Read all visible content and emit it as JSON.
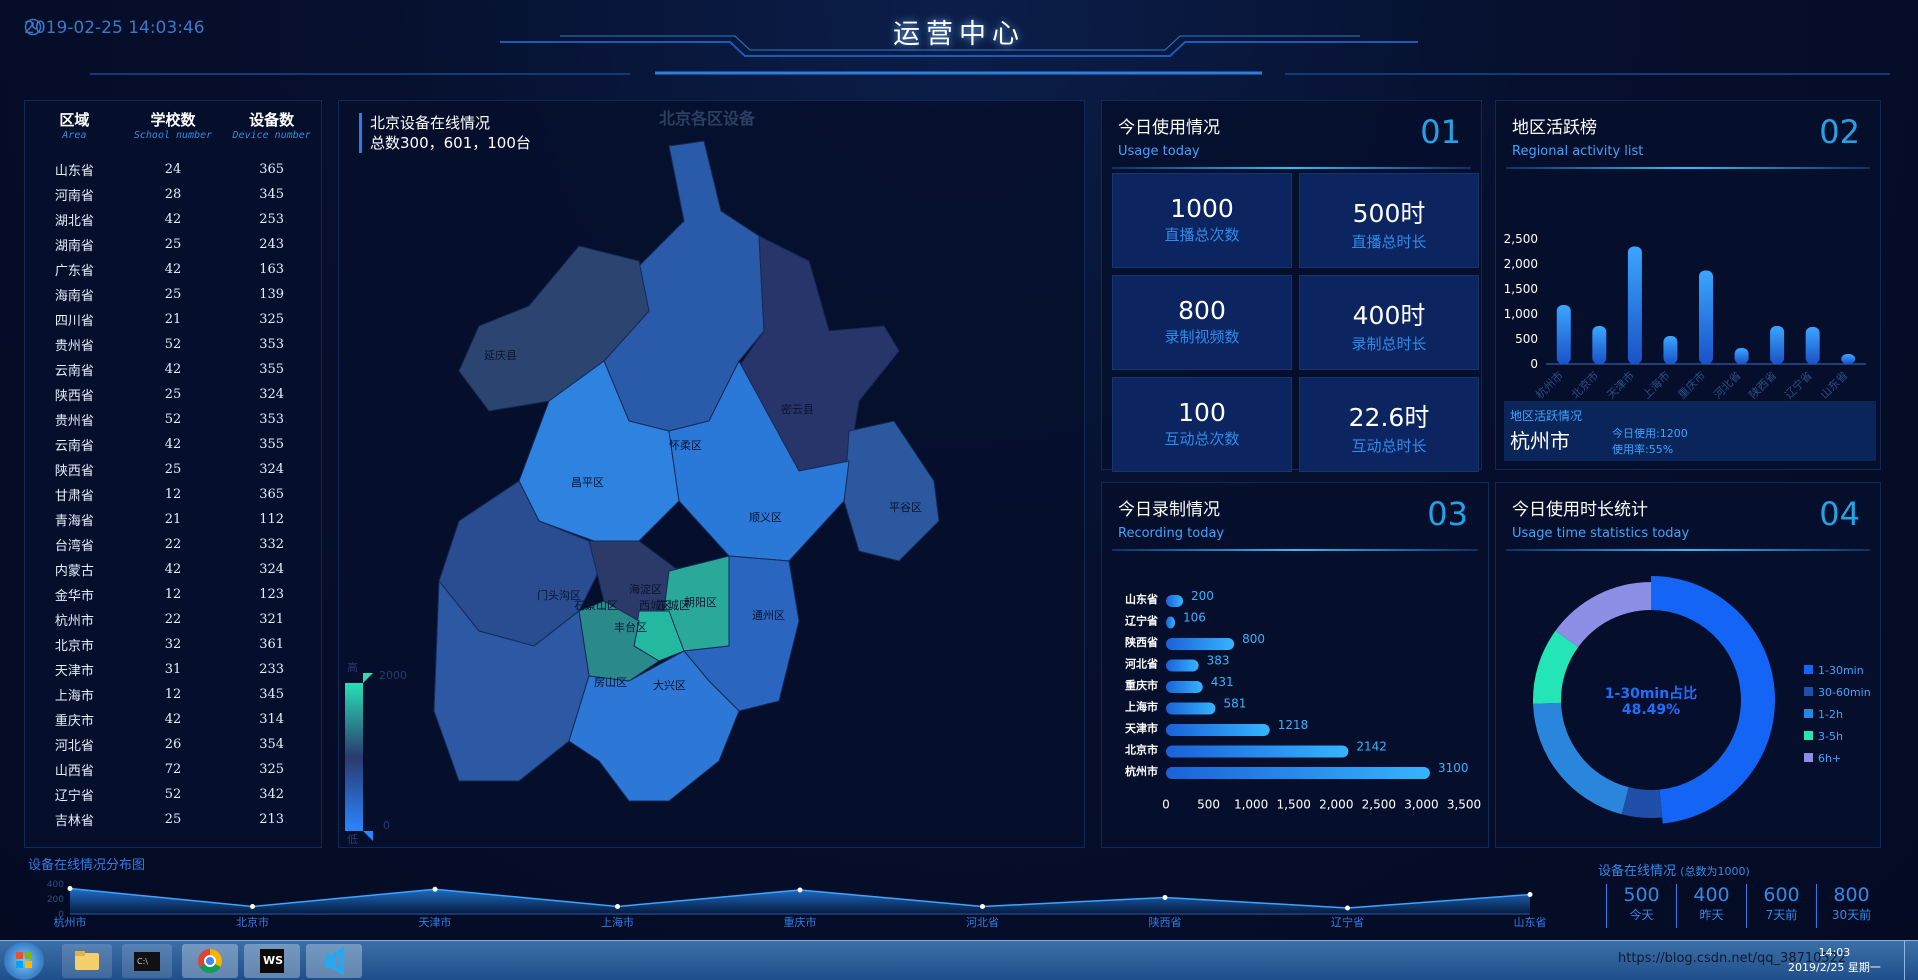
{
  "header": {
    "datetime": "2019-02-25 14:03:46",
    "title": "运营中心"
  },
  "table": {
    "headers": [
      {
        "cn": "区域",
        "en": "Area"
      },
      {
        "cn": "学校数",
        "en": "School number"
      },
      {
        "cn": "设备数",
        "en": "Device number"
      }
    ],
    "rows": [
      [
        "山东省",
        "24",
        "365"
      ],
      [
        "河南省",
        "28",
        "345"
      ],
      [
        "湖北省",
        "42",
        "253"
      ],
      [
        "湖南省",
        "25",
        "243"
      ],
      [
        "广东省",
        "42",
        "163"
      ],
      [
        "海南省",
        "25",
        "139"
      ],
      [
        "四川省",
        "21",
        "325"
      ],
      [
        "贵州省",
        "52",
        "353"
      ],
      [
        "云南省",
        "42",
        "355"
      ],
      [
        "陕西省",
        "25",
        "324"
      ],
      [
        "贵州省",
        "52",
        "353"
      ],
      [
        "云南省",
        "42",
        "355"
      ],
      [
        "陕西省",
        "25",
        "324"
      ],
      [
        "甘肃省",
        "12",
        "365"
      ],
      [
        "青海省",
        "21",
        "112"
      ],
      [
        "台湾省",
        "22",
        "332"
      ],
      [
        "内蒙古",
        "42",
        "324"
      ],
      [
        "金华市",
        "12",
        "123"
      ],
      [
        "杭州市",
        "22",
        "321"
      ],
      [
        "北京市",
        "32",
        "361"
      ],
      [
        "天津市",
        "31",
        "233"
      ],
      [
        "上海市",
        "12",
        "345"
      ],
      [
        "重庆市",
        "42",
        "314"
      ],
      [
        "河北省",
        "26",
        "354"
      ],
      [
        "山西省",
        "72",
        "325"
      ],
      [
        "辽宁省",
        "52",
        "342"
      ],
      [
        "吉林省",
        "25",
        "213"
      ]
    ]
  },
  "map": {
    "title": "北京设备在线情况",
    "subtitle": "总数300，601，100台",
    "bg_title": "北京各区设备",
    "legend": {
      "high": "高",
      "low": "低",
      "max": "2000",
      "min": "0"
    },
    "districts": [
      "延庆县",
      "怀柔区",
      "密云县",
      "昌平区",
      "顺义区",
      "平谷区",
      "门头沟区",
      "海淀区",
      "石景山区",
      "西城区",
      "东城区",
      "朝阳区",
      "丰台区",
      "通州区",
      "房山区",
      "大兴区"
    ]
  },
  "usage": {
    "title": "今日使用情况",
    "subtitle": "Usage today",
    "num": "01",
    "tiles": [
      {
        "value": "1000",
        "label": "直播总次数"
      },
      {
        "value": "500时",
        "label": "直播总时长"
      },
      {
        "value": "800",
        "label": "录制视频数"
      },
      {
        "value": "400时",
        "label": "录制总时长"
      },
      {
        "value": "100",
        "label": "互动总次数"
      },
      {
        "value": "22.6时",
        "label": "互动总时长"
      }
    ]
  },
  "activity": {
    "title": "地区活跃榜",
    "subtitle": "Regional activity list",
    "num": "02",
    "info": {
      "label": "地区活跃情况",
      "city": "杭州市",
      "today": "今日使用:1200",
      "rate": "使用率:55%"
    }
  },
  "recording": {
    "title": "今日录制情况",
    "subtitle": "Recording today",
    "num": "03"
  },
  "duration": {
    "title": "今日使用时长统计",
    "subtitle": "Usage time statistics today",
    "num": "04",
    "center_l1": "1-30min占比",
    "center_l2": "48.49%"
  },
  "online": {
    "title": "设备在线情况分布图"
  },
  "stats": {
    "title": "设备在线情况",
    "note": "(总数为1000)",
    "items": [
      {
        "value": "500",
        "label": "今天"
      },
      {
        "value": "400",
        "label": "昨天"
      },
      {
        "value": "600",
        "label": "7天前"
      },
      {
        "value": "800",
        "label": "30天前"
      }
    ]
  },
  "taskbar": {
    "time": "14:03",
    "date": "2019/2/25 星期一",
    "url": "https://blog.csdn.net/qq_38710522"
  },
  "colors": {
    "bg": "#040b24",
    "accent": "#2f8be8",
    "teal": "#28d2b0",
    "blue": "#1f6fff"
  },
  "chart_data": [
    {
      "type": "bar",
      "title": "地区活跃榜",
      "categories": [
        "杭州市",
        "北京市",
        "天津市",
        "上海市",
        "重庆市",
        "河北省",
        "陕西省",
        "辽宁省",
        "山东省"
      ],
      "values": [
        1180,
        760,
        2350,
        560,
        1870,
        320,
        760,
        740,
        200
      ],
      "ylim": [
        0,
        2500
      ],
      "yticks": [
        "2,500",
        "2,000",
        "1,500",
        "1,000",
        "500",
        "0"
      ]
    },
    {
      "type": "bar",
      "orientation": "horizontal",
      "title": "今日录制情况",
      "categories": [
        "山东省",
        "辽宁省",
        "陕西省",
        "河北省",
        "重庆市",
        "上海市",
        "天津市",
        "北京市",
        "杭州市"
      ],
      "values": [
        200,
        106,
        800,
        383,
        431,
        581,
        1218,
        2142,
        3100
      ],
      "xlim": [
        0,
        3500
      ],
      "xticks": [
        "0",
        "500",
        "1,000",
        "1,500",
        "2,000",
        "2,500",
        "3,000",
        "3,500"
      ]
    },
    {
      "type": "pie",
      "title": "今日使用时长统计",
      "series": [
        {
          "name": "1-30min",
          "value": 48.49,
          "color": "#1465f5"
        },
        {
          "name": "30-60min",
          "value": 5.5,
          "color": "#1f4fa8"
        },
        {
          "name": "1-2h",
          "value": 20.5,
          "color": "#2a86dc"
        },
        {
          "name": "3-5h",
          "value": 10.5,
          "color": "#24e5b5"
        },
        {
          "name": "6h+",
          "value": 15,
          "color": "#8d8ee6"
        }
      ]
    },
    {
      "type": "area",
      "title": "设备在线情况分布图",
      "categories": [
        "杭州市",
        "北京市",
        "天津市",
        "上海市",
        "重庆市",
        "河北省",
        "陕西省",
        "辽宁省",
        "山东省"
      ],
      "values": [
        340,
        100,
        330,
        100,
        320,
        100,
        220,
        80,
        260
      ],
      "ylim": [
        0,
        400
      ],
      "yticks": [
        "400",
        "200",
        "0"
      ]
    }
  ]
}
